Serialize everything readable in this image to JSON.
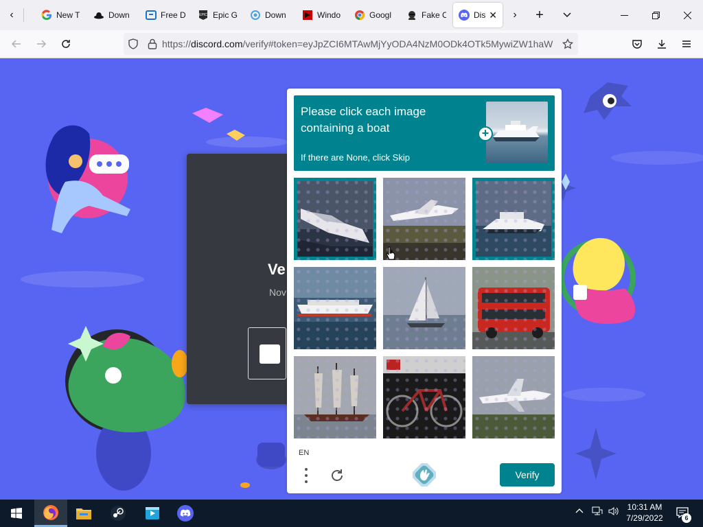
{
  "browser": {
    "tabs": [
      {
        "label": "New T",
        "icon": "google-icon"
      },
      {
        "label": "Down",
        "icon": "hat-icon"
      },
      {
        "label": "Free D",
        "icon": "free-icon"
      },
      {
        "label": "Epic G",
        "icon": "epic-games-icon"
      },
      {
        "label": "Down",
        "icon": "spiral-icon"
      },
      {
        "label": "Windo",
        "icon": "red-square-icon"
      },
      {
        "label": "Googl",
        "icon": "chrome-icon"
      },
      {
        "label": "Fake C",
        "icon": "spy-icon"
      },
      {
        "label": "Dis",
        "icon": "discord-icon",
        "active": true
      }
    ],
    "url": {
      "prefix": "https://",
      "host": "discord.com",
      "rest": "/verify#token=eyJpZCI6MTAwMjYyODA4NzM0ODk4OTk5MywiZW1haW"
    }
  },
  "page": {
    "bg_title": "Ve",
    "bg_subtitle": "Nov"
  },
  "captcha": {
    "prompt": "Please click each image containing a boat",
    "hint": "If there are None, click Skip",
    "language": "EN",
    "verify_label": "Verify",
    "tiles": [
      {
        "subject": "speedboat",
        "selected": true
      },
      {
        "subject": "airplane",
        "selected": false
      },
      {
        "subject": "yacht",
        "selected": true
      },
      {
        "subject": "cruise-ship",
        "selected": false
      },
      {
        "subject": "sailboat",
        "selected": false
      },
      {
        "subject": "double-decker-bus",
        "selected": false
      },
      {
        "subject": "tall-ship",
        "selected": false
      },
      {
        "subject": "bicycle",
        "selected": false
      },
      {
        "subject": "airplane",
        "selected": false
      }
    ],
    "accent_color": "#00838f"
  },
  "taskbar": {
    "apps": [
      "firefox-icon",
      "file-explorer-icon",
      "steam-icon",
      "media-icon",
      "discord-icon"
    ],
    "time": "10:31 AM",
    "date": "7/29/2022",
    "notifications": "6"
  }
}
